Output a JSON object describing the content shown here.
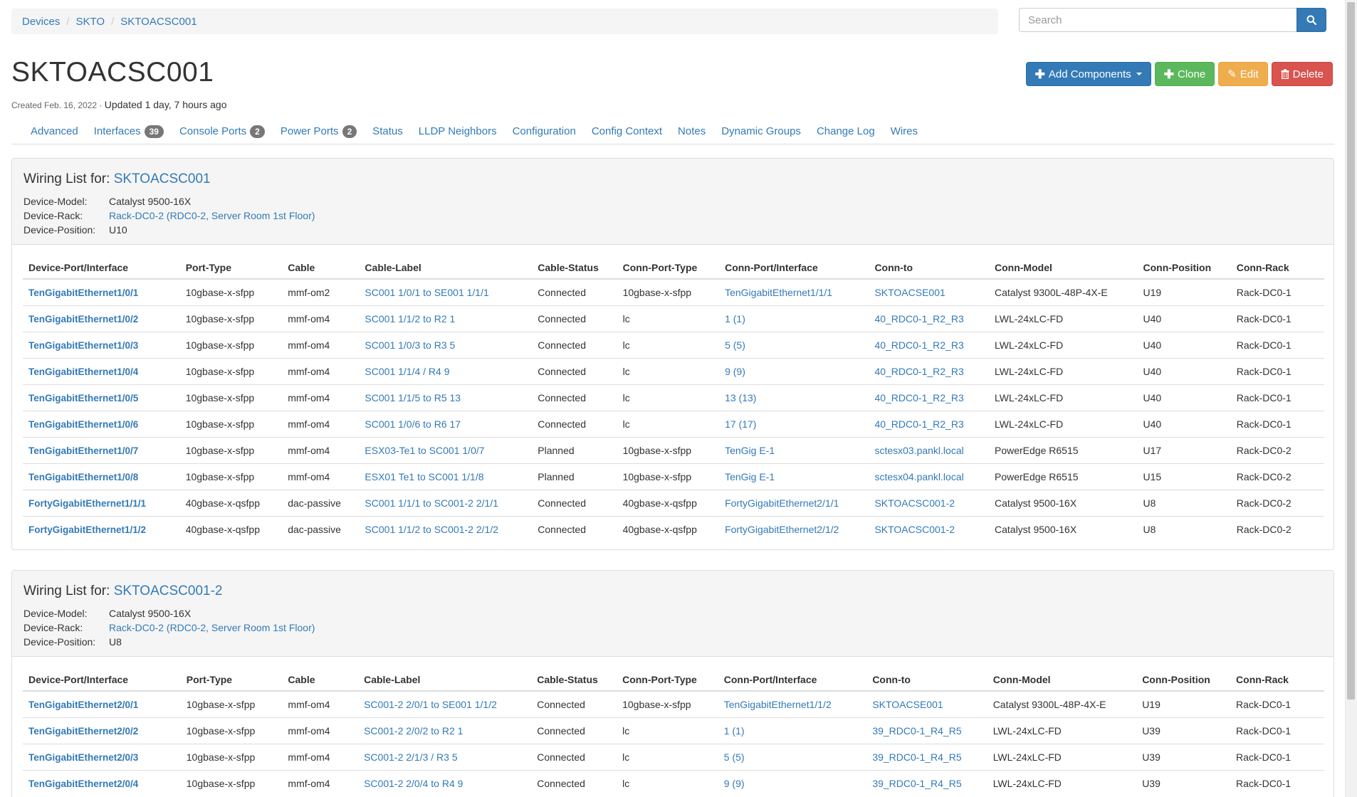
{
  "breadcrumb": [
    "Devices",
    "SKTO",
    "SKTOACSC001"
  ],
  "search": {
    "placeholder": "Search"
  },
  "device": {
    "name": "SKTOACSC001",
    "created_label": "Created Feb. 16, 2022 · ",
    "updated_label": "Updated 1 day, 7 hours ago"
  },
  "actions": {
    "add_components": "Add Components",
    "clone": "Clone",
    "edit": "Edit",
    "delete": "Delete"
  },
  "tabs": [
    {
      "label": "Advanced"
    },
    {
      "label": "Interfaces",
      "badge": "39"
    },
    {
      "label": "Console Ports",
      "badge": "2"
    },
    {
      "label": "Power Ports",
      "badge": "2"
    },
    {
      "label": "Status"
    },
    {
      "label": "LLDP Neighbors"
    },
    {
      "label": "Configuration"
    },
    {
      "label": "Config Context"
    },
    {
      "label": "Notes"
    },
    {
      "label": "Dynamic Groups"
    },
    {
      "label": "Change Log"
    },
    {
      "label": "Wires"
    }
  ],
  "columns": [
    "Device-Port/Interface",
    "Port-Type",
    "Cable",
    "Cable-Label",
    "Cable-Status",
    "Conn-Port-Type",
    "Conn-Port/Interface",
    "Conn-to",
    "Conn-Model",
    "Conn-Position",
    "Conn-Rack"
  ],
  "wiring_lists": [
    {
      "heading": "Wiring List for: ",
      "device": "SKTOACSC001",
      "model_label": "Device-Model:",
      "model": "Catalyst 9500-16X",
      "rack_label": "Device-Rack:",
      "rack": "Rack-DC0-2 (RDC0-2, Server Room 1st Floor)",
      "position_label": "Device-Position:",
      "position": "U10",
      "rows": [
        [
          "TenGigabitEthernet1/0/1",
          "10gbase-x-sfpp",
          "mmf-om2",
          "SC001 1/0/1 to SE001 1/1/1",
          "Connected",
          "10gbase-x-sfpp",
          "TenGigabitEthernet1/1/1",
          "SKTOACSE001",
          "Catalyst 9300L-48P-4X-E",
          "U19",
          "Rack-DC0-1"
        ],
        [
          "TenGigabitEthernet1/0/2",
          "10gbase-x-sfpp",
          "mmf-om4",
          "SC001 1/1/2 to R2 1",
          "Connected",
          "lc",
          "1 (1)",
          "40_RDC0-1_R2_R3",
          "LWL-24xLC-FD",
          "U40",
          "Rack-DC0-1"
        ],
        [
          "TenGigabitEthernet1/0/3",
          "10gbase-x-sfpp",
          "mmf-om4",
          "SC001 1/0/3 to R3 5",
          "Connected",
          "lc",
          "5 (5)",
          "40_RDC0-1_R2_R3",
          "LWL-24xLC-FD",
          "U40",
          "Rack-DC0-1"
        ],
        [
          "TenGigabitEthernet1/0/4",
          "10gbase-x-sfpp",
          "mmf-om4",
          "SC001 1/1/4 / R4 9",
          "Connected",
          "lc",
          "9 (9)",
          "40_RDC0-1_R2_R3",
          "LWL-24xLC-FD",
          "U40",
          "Rack-DC0-1"
        ],
        [
          "TenGigabitEthernet1/0/5",
          "10gbase-x-sfpp",
          "mmf-om4",
          "SC001 1/1/5 to R5 13",
          "Connected",
          "lc",
          "13 (13)",
          "40_RDC0-1_R2_R3",
          "LWL-24xLC-FD",
          "U40",
          "Rack-DC0-1"
        ],
        [
          "TenGigabitEthernet1/0/6",
          "10gbase-x-sfpp",
          "mmf-om4",
          "SC001 1/0/6 to R6 17",
          "Connected",
          "lc",
          "17 (17)",
          "40_RDC0-1_R2_R3",
          "LWL-24xLC-FD",
          "U40",
          "Rack-DC0-1"
        ],
        [
          "TenGigabitEthernet1/0/7",
          "10gbase-x-sfpp",
          "mmf-om4",
          "ESX03-Te1 to SC001 1/0/7",
          "Planned",
          "10gbase-x-sfpp",
          "TenGig E-1",
          "sctesx03.pankl.local",
          "PowerEdge R6515",
          "U17",
          "Rack-DC0-2"
        ],
        [
          "TenGigabitEthernet1/0/8",
          "10gbase-x-sfpp",
          "mmf-om4",
          "ESX01 Te1 to SC001 1/1/8",
          "Planned",
          "10gbase-x-sfpp",
          "TenGig E-1",
          "sctesx04.pankl.local",
          "PowerEdge R6515",
          "U15",
          "Rack-DC0-2"
        ],
        [
          "FortyGigabitEthernet1/1/1",
          "40gbase-x-qsfpp",
          "dac-passive",
          "SC001 1/1/1 to SC001-2 2/1/1",
          "Connected",
          "40gbase-x-qsfpp",
          "FortyGigabitEthernet2/1/1",
          "SKTOACSC001-2",
          "Catalyst 9500-16X",
          "U8",
          "Rack-DC0-2"
        ],
        [
          "FortyGigabitEthernet1/1/2",
          "40gbase-x-qsfpp",
          "dac-passive",
          "SC001 1/1/2 to SC001-2 2/1/2",
          "Connected",
          "40gbase-x-qsfpp",
          "FortyGigabitEthernet2/1/2",
          "SKTOACSC001-2",
          "Catalyst 9500-16X",
          "U8",
          "Rack-DC0-2"
        ]
      ]
    },
    {
      "heading": "Wiring List for: ",
      "device": "SKTOACSC001-2",
      "model_label": "Device-Model:",
      "model": "Catalyst 9500-16X",
      "rack_label": "Device-Rack:",
      "rack": "Rack-DC0-2 (RDC0-2, Server Room 1st Floor)",
      "position_label": "Device-Position:",
      "position": "U8",
      "rows": [
        [
          "TenGigabitEthernet2/0/1",
          "10gbase-x-sfpp",
          "mmf-om4",
          "SC001-2 2/0/1 to SE001 1/1/2",
          "Connected",
          "10gbase-x-sfpp",
          "TenGigabitEthernet1/1/2",
          "SKTOACSE001",
          "Catalyst 9300L-48P-4X-E",
          "U19",
          "Rack-DC0-1"
        ],
        [
          "TenGigabitEthernet2/0/2",
          "10gbase-x-sfpp",
          "mmf-om4",
          "SC001-2 2/0/2 to R2 1",
          "Connected",
          "lc",
          "1 (1)",
          "39_RDC0-1_R4_R5",
          "LWL-24xLC-FD",
          "U39",
          "Rack-DC0-1"
        ],
        [
          "TenGigabitEthernet2/0/3",
          "10gbase-x-sfpp",
          "mmf-om4",
          "SC001-2 2/1/3 / R3 5",
          "Connected",
          "lc",
          "5 (5)",
          "39_RDC0-1_R4_R5",
          "LWL-24xLC-FD",
          "U39",
          "Rack-DC0-1"
        ],
        [
          "TenGigabitEthernet2/0/4",
          "10gbase-x-sfpp",
          "mmf-om4",
          "SC001-2 2/0/4 to R4 9",
          "Connected",
          "lc",
          "9 (9)",
          "39_RDC0-1_R4_R5",
          "LWL-24xLC-FD",
          "U39",
          "Rack-DC0-1"
        ]
      ]
    }
  ]
}
